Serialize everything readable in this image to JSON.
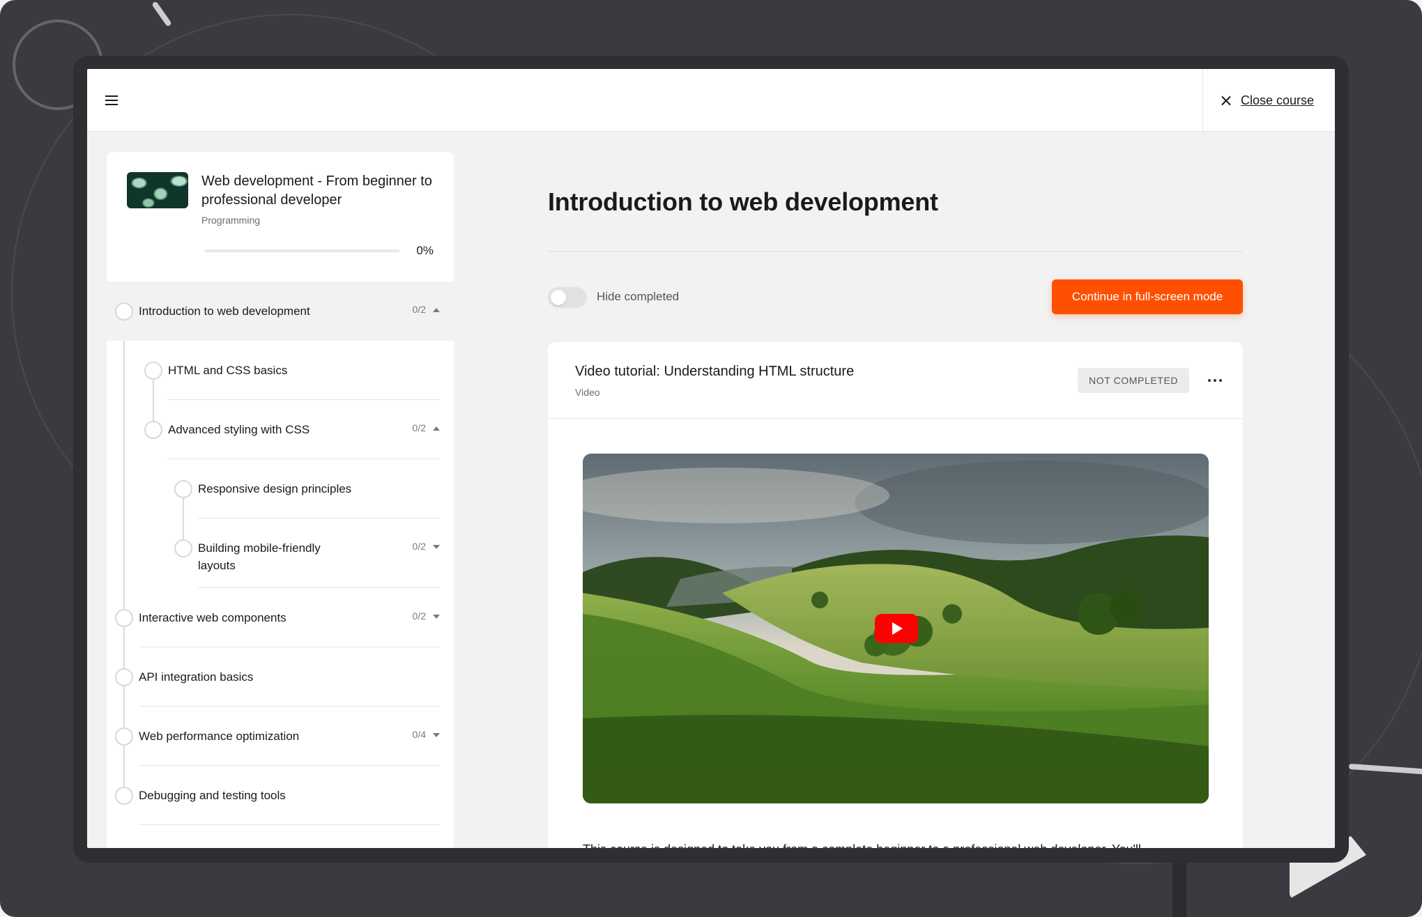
{
  "topbar": {
    "menu_icon": "hamburger-menu-icon",
    "close_label": "Close course",
    "close_icon": "close-x-icon"
  },
  "course": {
    "title": "Web development - From beginner to professional developer",
    "category": "Programming",
    "progress_value": 0,
    "progress_text": "0%"
  },
  "outline": [
    {
      "label": "Introduction to web development",
      "count": "0/2",
      "caret": "up",
      "level": 0,
      "active": true
    },
    {
      "label": "HTML and CSS basics",
      "count": "",
      "caret": "",
      "level": 1,
      "active": false
    },
    {
      "label": "Advanced styling with CSS",
      "count": "0/2",
      "caret": "up",
      "level": 1,
      "active": false
    },
    {
      "label": "Responsive design principles",
      "count": "",
      "caret": "",
      "level": 2,
      "active": false
    },
    {
      "label": "Building mobile-friendly layouts",
      "count": "0/2",
      "caret": "down",
      "level": 2,
      "active": false
    },
    {
      "label": "Interactive web components",
      "count": "0/2",
      "caret": "down",
      "level": 0,
      "active": false
    },
    {
      "label": "API integration basics",
      "count": "",
      "caret": "",
      "level": 0,
      "active": false
    },
    {
      "label": "Web performance optimization",
      "count": "0/4",
      "caret": "down",
      "level": 0,
      "active": false
    },
    {
      "label": "Debugging and testing tools",
      "count": "",
      "caret": "",
      "level": 0,
      "active": false
    }
  ],
  "main": {
    "title": "Introduction to web development",
    "toggle_label": "Hide completed",
    "toggle_on": false,
    "fullscreen_label": "Continue in full-screen mode",
    "accent_color": "#ff4f00"
  },
  "item": {
    "title": "Video tutorial: Understanding HTML structure",
    "type": "Video",
    "status": "NOT COMPLETED",
    "more_icon": "more-horizontal-icon",
    "video_icon": "play-icon",
    "description": "This course is designed to take you from a complete beginner to a professional web developer. You'll"
  }
}
